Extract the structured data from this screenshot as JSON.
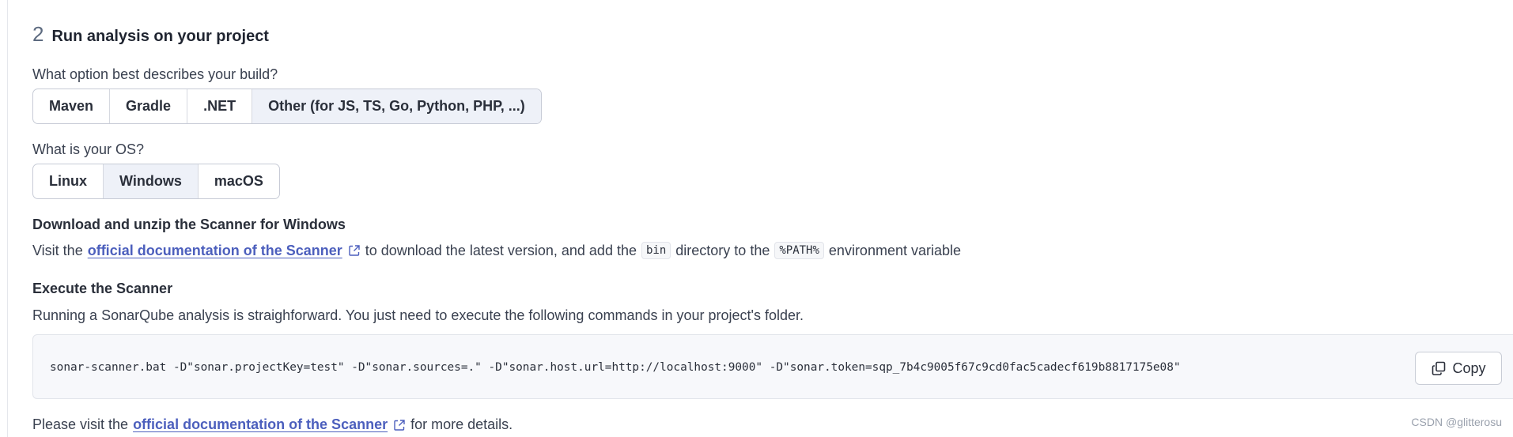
{
  "step": {
    "number": "2",
    "title": "Run analysis on your project"
  },
  "build": {
    "question": "What option best describes your build?",
    "options": [
      "Maven",
      "Gradle",
      ".NET",
      "Other (for JS, TS, Go, Python, PHP, ...)"
    ],
    "selected": "Other (for JS, TS, Go, Python, PHP, ...)"
  },
  "os": {
    "question": "What is your OS?",
    "options": [
      "Linux",
      "Windows",
      "macOS"
    ],
    "selected": "Windows"
  },
  "download": {
    "heading": "Download and unzip the Scanner for Windows",
    "prefix": "Visit the",
    "link_text": "official documentation of the Scanner",
    "middle": "to download the latest version, and add the",
    "code1": "bin",
    "middle2": "directory to the",
    "code2": "%PATH%",
    "suffix": "environment variable"
  },
  "execute": {
    "heading": "Execute the Scanner",
    "description": "Running a SonarQube analysis is straighforward. You just need to execute the following commands in your project's folder.",
    "command": "sonar-scanner.bat -D\"sonar.projectKey=test\" -D\"sonar.sources=.\" -D\"sonar.host.url=http://localhost:9000\" -D\"sonar.token=sqp_7b4c9005f67c9cd0fac5cadecf619b8817175e08\"",
    "copy_label": "Copy"
  },
  "footer": {
    "prefix": "Please visit the",
    "link_text": "official documentation of the Scanner",
    "suffix": "for more details."
  },
  "watermark": "CSDN @glitterosu",
  "colors": {
    "link": "#4c5fbd",
    "selected_bg": "#eef1f8",
    "code_bg": "#f7f8fb"
  }
}
